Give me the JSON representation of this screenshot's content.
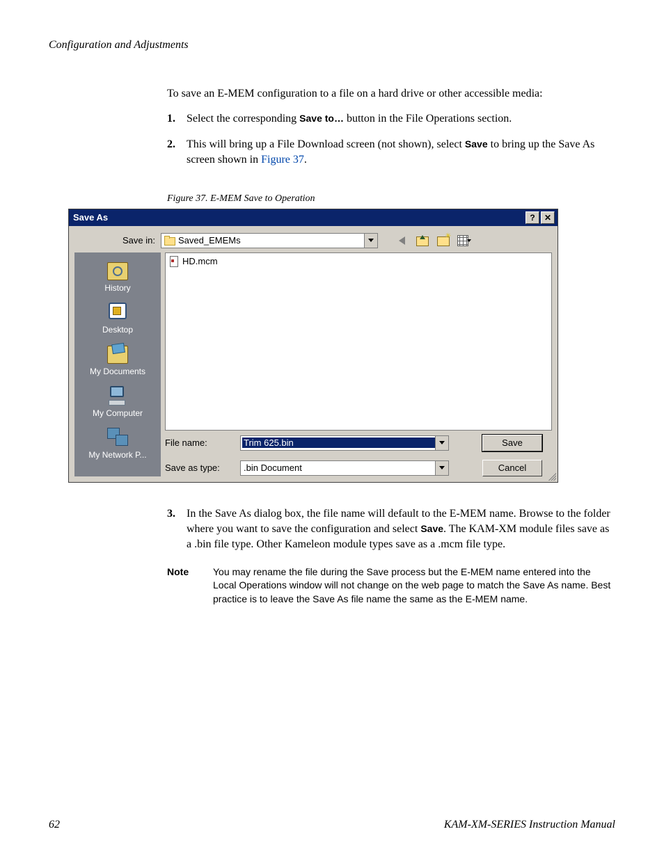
{
  "header": "Configuration and Adjustments",
  "intro": "To save an E-MEM configuration to a file on a hard drive or other accessible media:",
  "steps12": [
    {
      "num": "1.",
      "pre": "Select the corresponding ",
      "bold": "Save to…",
      "post": " button in the File Operations section."
    },
    {
      "num": "2.",
      "pre": "This will bring up a File Download screen (not shown), select ",
      "bold": "Save",
      "post": " to bring up the Save As screen shown in ",
      "link": "Figure 37",
      "post2": "."
    }
  ],
  "figcaption": "Figure 37.  E-MEM Save to Operation",
  "dialog": {
    "title": "Save As",
    "help_btn": "?",
    "close_btn": "✕",
    "save_in_label": "Save in:",
    "save_in_folder": "Saved_EMEMs",
    "places": [
      {
        "label": "History",
        "ico": "ico-history"
      },
      {
        "label": "Desktop",
        "ico": "ico-desktop"
      },
      {
        "label": "My Documents",
        "ico": "ico-docs"
      },
      {
        "label": "My Computer",
        "ico": "ico-computer"
      },
      {
        "label": "My Network P...",
        "ico": "ico-network"
      }
    ],
    "file_in_list": "HD.mcm",
    "file_name_label": "File name:",
    "file_name_value": "Trim 625.bin",
    "save_type_label": "Save as type:",
    "save_type_value": ".bin Document",
    "save_btn": "Save",
    "cancel_btn": "Cancel"
  },
  "step3": {
    "num": "3.",
    "pre": "In the Save As dialog box, the file name will default to the E-MEM name. Browse to the folder where you want to save the configuration and select ",
    "bold": "Save",
    "post": ". The KAM-XM module files save as a .bin file type. Other Kameleon module types save as a .mcm file type."
  },
  "note_label": "Note",
  "note_text": "You may rename the file during the Save process but the E-MEM name entered into the Local Operations window will not change on the web page to match the Save As name. Best practice is to leave the Save As file name the same as the E-MEM name.",
  "page_num": "62",
  "manual_title": "KAM-XM-SERIES Instruction Manual"
}
